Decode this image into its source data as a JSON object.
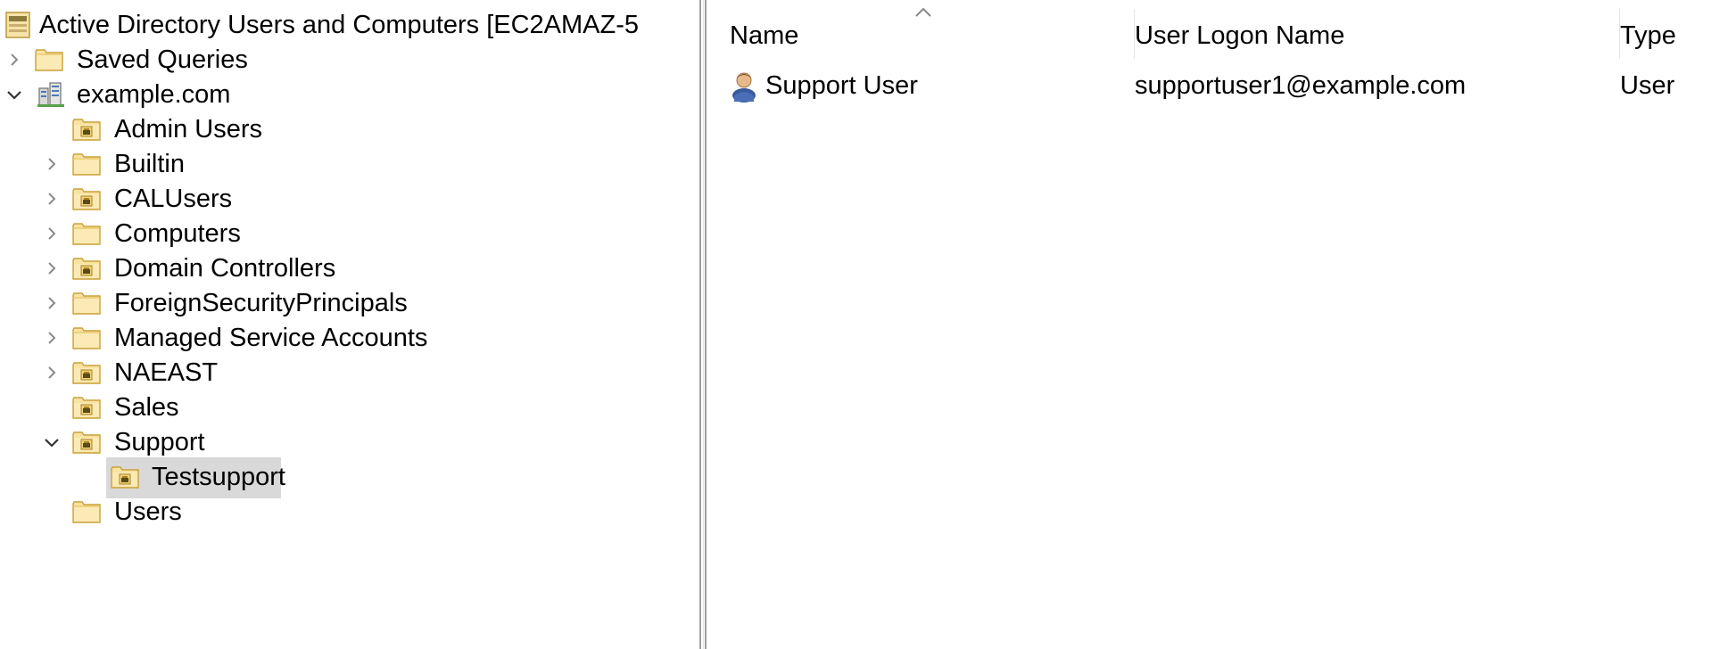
{
  "tree": {
    "root": "Active Directory Users and Computers [EC2AMAZ-5",
    "saved_queries": "Saved Queries",
    "domain": "example.com",
    "ous": {
      "admin_users": "Admin Users",
      "builtin": "Builtin",
      "calusers": "CALUsers",
      "computers": "Computers",
      "domain_controllers": "Domain Controllers",
      "foreign_security_principals": "ForeignSecurityPrincipals",
      "managed_service_accounts": "Managed Service Accounts",
      "naeast": "NAEAST",
      "sales": "Sales",
      "support": "Support",
      "testsupport": "Testsupport",
      "users": "Users"
    }
  },
  "list": {
    "columns": {
      "name": "Name",
      "logon": "User Logon Name",
      "type": "Type"
    },
    "rows": [
      {
        "name": "Support User",
        "logon": "supportuser1@example.com",
        "type": "User"
      }
    ]
  },
  "icons": {
    "folder": "folder-icon",
    "ou_folder": "organizational-unit-icon",
    "domain": "domain-icon",
    "root": "snapin-root-icon",
    "user": "user-icon",
    "expand": "chevron-right-icon",
    "collapse": "chevron-down-icon",
    "sort": "sort-ascending-icon"
  },
  "colors": {
    "selection": "#d9d9d9",
    "folder_fill": "#f7dc8c",
    "folder_edge": "#c9a13a"
  }
}
